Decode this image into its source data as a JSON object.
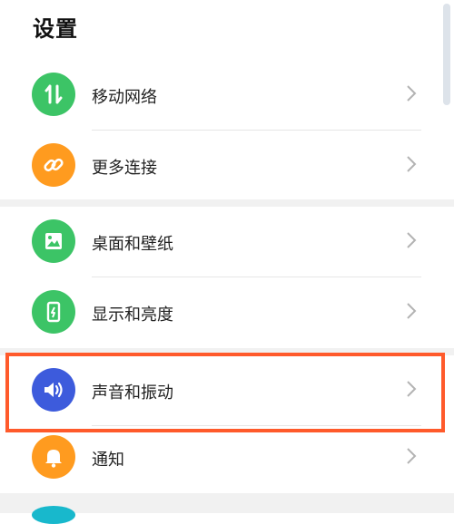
{
  "header": {
    "title": "设置"
  },
  "items": [
    {
      "label": "移动网络",
      "icon": "arrows-updown-icon",
      "color": "#3cc466"
    },
    {
      "label": "更多连接",
      "icon": "link-icon",
      "color": "#ff9b1f"
    },
    {
      "label": "桌面和壁纸",
      "icon": "image-icon",
      "color": "#3cc466"
    },
    {
      "label": "显示和亮度",
      "icon": "phone-brightness-icon",
      "color": "#3cc466"
    },
    {
      "label": "声音和振动",
      "icon": "speaker-icon",
      "color": "#3d5bdc"
    },
    {
      "label": "通知",
      "icon": "bell-icon",
      "color": "#ff9b1f"
    }
  ],
  "colors": {
    "highlight": "#ff5a2b",
    "background": "#ffffff",
    "section_gap": "#f1f1f1"
  }
}
